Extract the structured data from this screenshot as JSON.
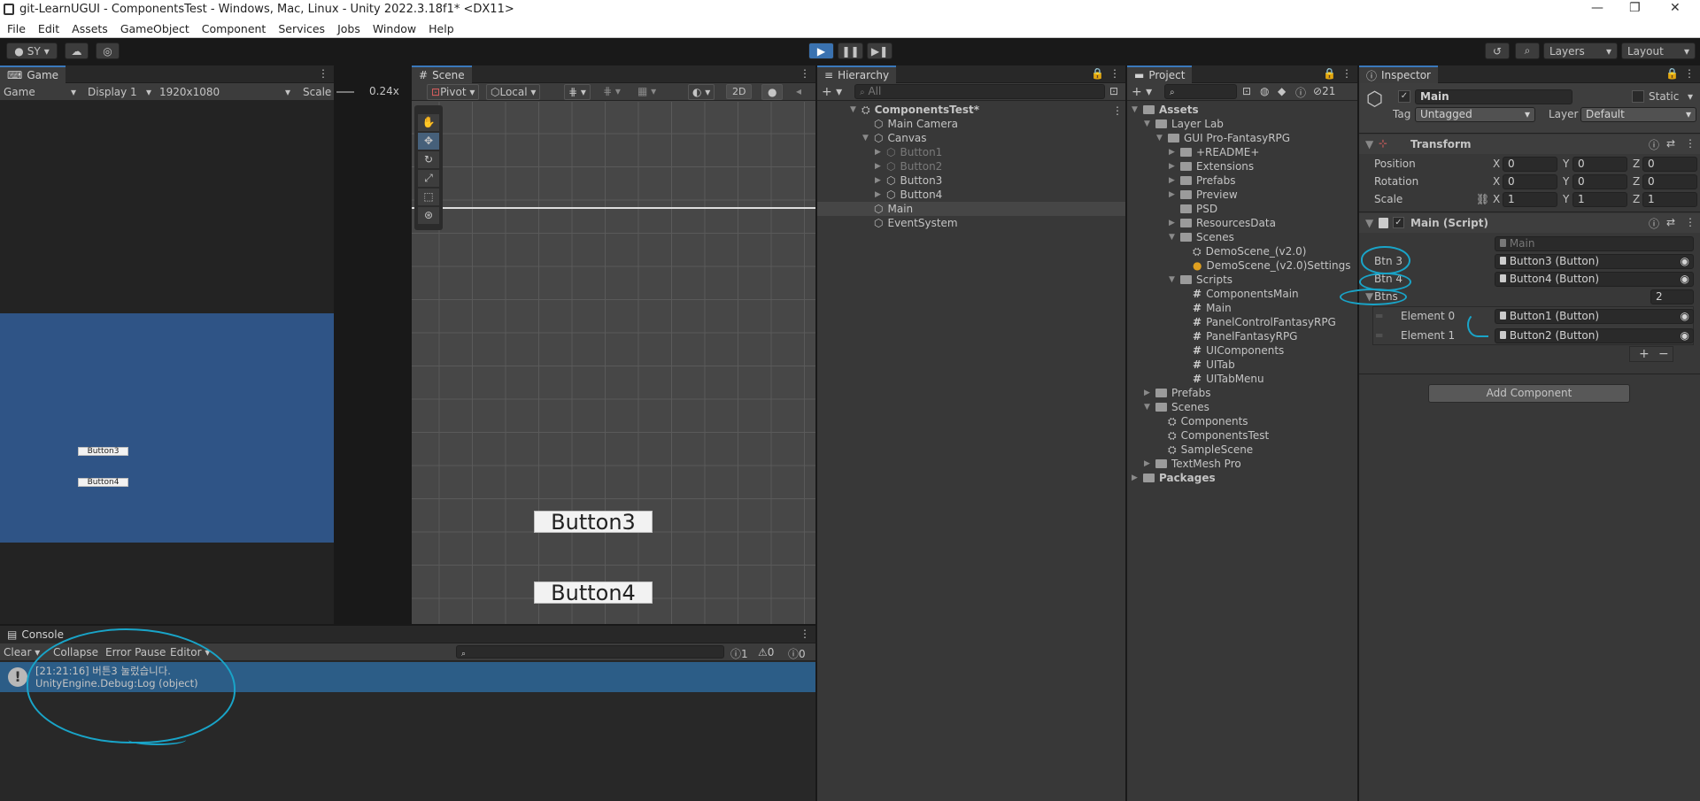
{
  "window": {
    "title": "git-LearnUGUI - ComponentsTest - Windows, Mac, Linux - Unity 2022.3.18f1* <DX11>"
  },
  "menu": [
    "File",
    "Edit",
    "Assets",
    "GameObject",
    "Component",
    "Services",
    "Jobs",
    "Window",
    "Help"
  ],
  "toolbar": {
    "account": "SY",
    "layers": "Layers",
    "layout": "Layout"
  },
  "game": {
    "tab": "Game",
    "mode": "Game",
    "display": "Display 1",
    "resolution": "1920x1080",
    "scale_label": "Scale",
    "scale_value": "0.24x",
    "button3": "Button3",
    "button4": "Button4"
  },
  "scene": {
    "tab": "Scene",
    "pivot": "Pivot",
    "local": "Local",
    "mode2d": "2D",
    "button3": "Button3",
    "button4": "Button4"
  },
  "hierarchy": {
    "tab": "Hierarchy",
    "search_placeholder": "All",
    "items": [
      {
        "label": "ComponentsTest*",
        "depth": 0,
        "arrow": "▼",
        "type": "scene",
        "dim": false,
        "bold": true
      },
      {
        "label": "Main Camera",
        "depth": 1,
        "arrow": "",
        "type": "obj",
        "dim": false
      },
      {
        "label": "Canvas",
        "depth": 1,
        "arrow": "▼",
        "type": "obj",
        "dim": false
      },
      {
        "label": "Button1",
        "depth": 2,
        "arrow": "▶",
        "type": "obj",
        "dim": true
      },
      {
        "label": "Button2",
        "depth": 2,
        "arrow": "▶",
        "type": "obj",
        "dim": true
      },
      {
        "label": "Button3",
        "depth": 2,
        "arrow": "▶",
        "type": "obj",
        "dim": false
      },
      {
        "label": "Button4",
        "depth": 2,
        "arrow": "▶",
        "type": "obj",
        "dim": false
      },
      {
        "label": "Main",
        "depth": 1,
        "arrow": "",
        "type": "obj",
        "dim": false,
        "selected": true
      },
      {
        "label": "EventSystem",
        "depth": 1,
        "arrow": "",
        "type": "obj",
        "dim": false
      }
    ]
  },
  "project": {
    "tab": "Project",
    "hidden_count": "21",
    "items": [
      {
        "label": "Assets",
        "depth": 0,
        "arrow": "▼",
        "type": "folder",
        "bold": true
      },
      {
        "label": "Layer Lab",
        "depth": 1,
        "arrow": "▼",
        "type": "folder"
      },
      {
        "label": "GUI Pro-FantasyRPG",
        "depth": 2,
        "arrow": "▼",
        "type": "folder"
      },
      {
        "label": "+README+",
        "depth": 3,
        "arrow": "▶",
        "type": "folder"
      },
      {
        "label": "Extensions",
        "depth": 3,
        "arrow": "▶",
        "type": "folder"
      },
      {
        "label": "Prefabs",
        "depth": 3,
        "arrow": "▶",
        "type": "folder"
      },
      {
        "label": "Preview",
        "depth": 3,
        "arrow": "▶",
        "type": "folder"
      },
      {
        "label": "PSD",
        "depth": 3,
        "arrow": "",
        "type": "folder"
      },
      {
        "label": "ResourcesData",
        "depth": 3,
        "arrow": "▶",
        "type": "folder"
      },
      {
        "label": "Scenes",
        "depth": 3,
        "arrow": "▼",
        "type": "folder"
      },
      {
        "label": "DemoScene_(v2.0)",
        "depth": 4,
        "arrow": "",
        "type": "scene"
      },
      {
        "label": "DemoScene_(v2.0)Settings",
        "depth": 4,
        "arrow": "",
        "type": "settings"
      },
      {
        "label": "Scripts",
        "depth": 3,
        "arrow": "▼",
        "type": "folder"
      },
      {
        "label": "ComponentsMain",
        "depth": 4,
        "arrow": "",
        "type": "script"
      },
      {
        "label": "Main",
        "depth": 4,
        "arrow": "",
        "type": "script"
      },
      {
        "label": "PanelControlFantasyRPG",
        "depth": 4,
        "arrow": "",
        "type": "script"
      },
      {
        "label": "PanelFantasyRPG",
        "depth": 4,
        "arrow": "",
        "type": "script"
      },
      {
        "label": "UIComponents",
        "depth": 4,
        "arrow": "",
        "type": "script"
      },
      {
        "label": "UITab",
        "depth": 4,
        "arrow": "",
        "type": "script"
      },
      {
        "label": "UITabMenu",
        "depth": 4,
        "arrow": "",
        "type": "script"
      },
      {
        "label": "Prefabs",
        "depth": 1,
        "arrow": "▶",
        "type": "folder"
      },
      {
        "label": "Scenes",
        "depth": 1,
        "arrow": "▼",
        "type": "folder"
      },
      {
        "label": "Components",
        "depth": 2,
        "arrow": "",
        "type": "scene"
      },
      {
        "label": "ComponentsTest",
        "depth": 2,
        "arrow": "",
        "type": "scene"
      },
      {
        "label": "SampleScene",
        "depth": 2,
        "arrow": "",
        "type": "scene"
      },
      {
        "label": "TextMesh Pro",
        "depth": 1,
        "arrow": "▶",
        "type": "folder"
      },
      {
        "label": "Packages",
        "depth": 0,
        "arrow": "▶",
        "type": "folder",
        "bold": true
      }
    ]
  },
  "inspector": {
    "tab": "Inspector",
    "object_name": "Main",
    "static_label": "Static",
    "tag_label": "Tag",
    "tag_value": "Untagged",
    "layer_label": "Layer",
    "layer_value": "Default",
    "transform": {
      "title": "Transform",
      "rows": [
        {
          "label": "Position",
          "x": "0",
          "y": "0",
          "z": "0"
        },
        {
          "label": "Rotation",
          "x": "0",
          "y": "0",
          "z": "0"
        },
        {
          "label": "Scale",
          "x": "1",
          "y": "1",
          "z": "1"
        }
      ]
    },
    "script": {
      "title": "Main (Script)",
      "script_value": "Main",
      "btn3_label": "Btn 3",
      "btn3_value": "Button3 (Button)",
      "btn4_label": "Btn 4",
      "btn4_value": "Button4 (Button)",
      "btns_label": "Btns",
      "btns_count": "2",
      "elements": [
        {
          "label": "Element 0",
          "value": "Button1 (Button)"
        },
        {
          "label": "Element 1",
          "value": "Button2 (Button)"
        }
      ]
    },
    "add_component": "Add Component"
  },
  "console": {
    "tab": "Console",
    "clear": "Clear",
    "collapse": "Collapse",
    "error_pause": "Error Pause",
    "editor": "Editor",
    "count_info": "1",
    "count_warn": "0",
    "count_error": "0",
    "log_line1": "[21:21:16] 버튼3 눌렀습니다.",
    "log_line2": "UnityEngine.Debug:Log (object)"
  },
  "colors": {
    "accent": "#3a79bb",
    "annotation": "#19a4c8",
    "canvas_blue": "#2f5486",
    "selection": "#2c5d87"
  }
}
